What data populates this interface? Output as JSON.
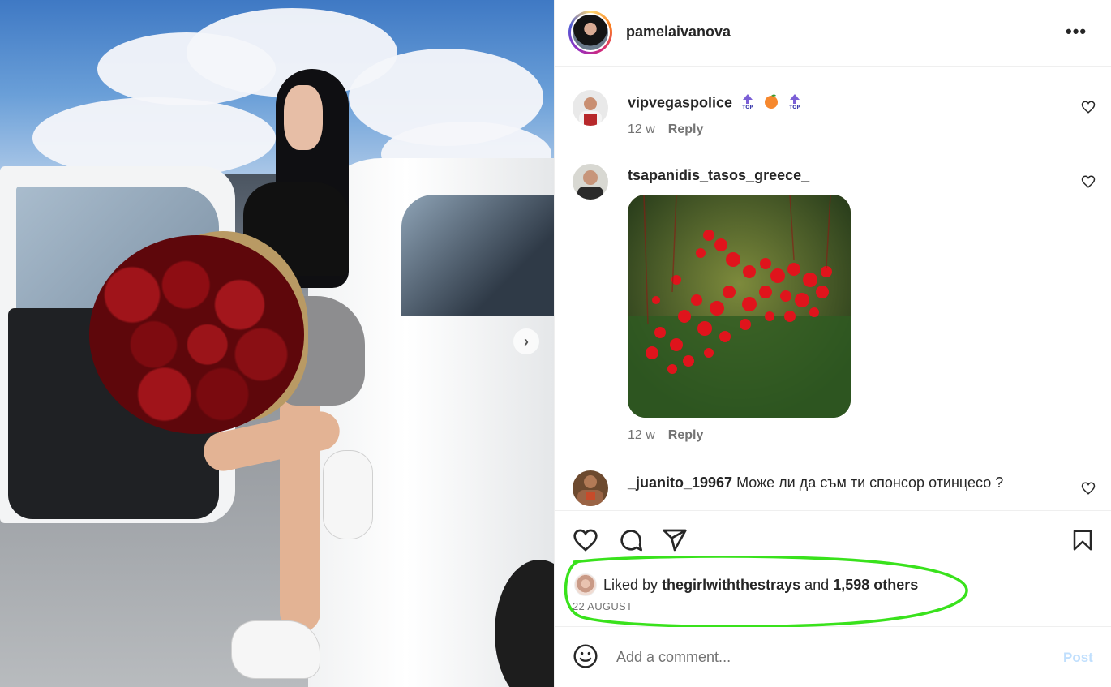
{
  "post": {
    "username": "pamelaivanova",
    "more_label": "•••"
  },
  "comments": [
    {
      "username": "vipvegaspolice",
      "text": "",
      "emojis": [
        "top-arrow-icon",
        "peach-icon",
        "top-arrow-icon"
      ],
      "age": "12 w",
      "reply_label": "Reply"
    },
    {
      "username": "tsapanidis_tasos_greece_",
      "text": "",
      "has_image": true,
      "age": "12 w",
      "reply_label": "Reply"
    },
    {
      "username": "_juanito_19967",
      "text": "Може ли да съм ти спонсор отинцесо ?"
    }
  ],
  "likes": {
    "prefix": "Liked by",
    "user": "thegirlwiththestrays",
    "joiner": "and",
    "others": "1,598 others",
    "date": "22 AUGUST"
  },
  "add_comment": {
    "placeholder": "Add a comment...",
    "post_label": "Post"
  },
  "colors": {
    "highlight": "#39e21c",
    "post_disabled": "#c0dffd",
    "meta_gray": "#737373"
  }
}
